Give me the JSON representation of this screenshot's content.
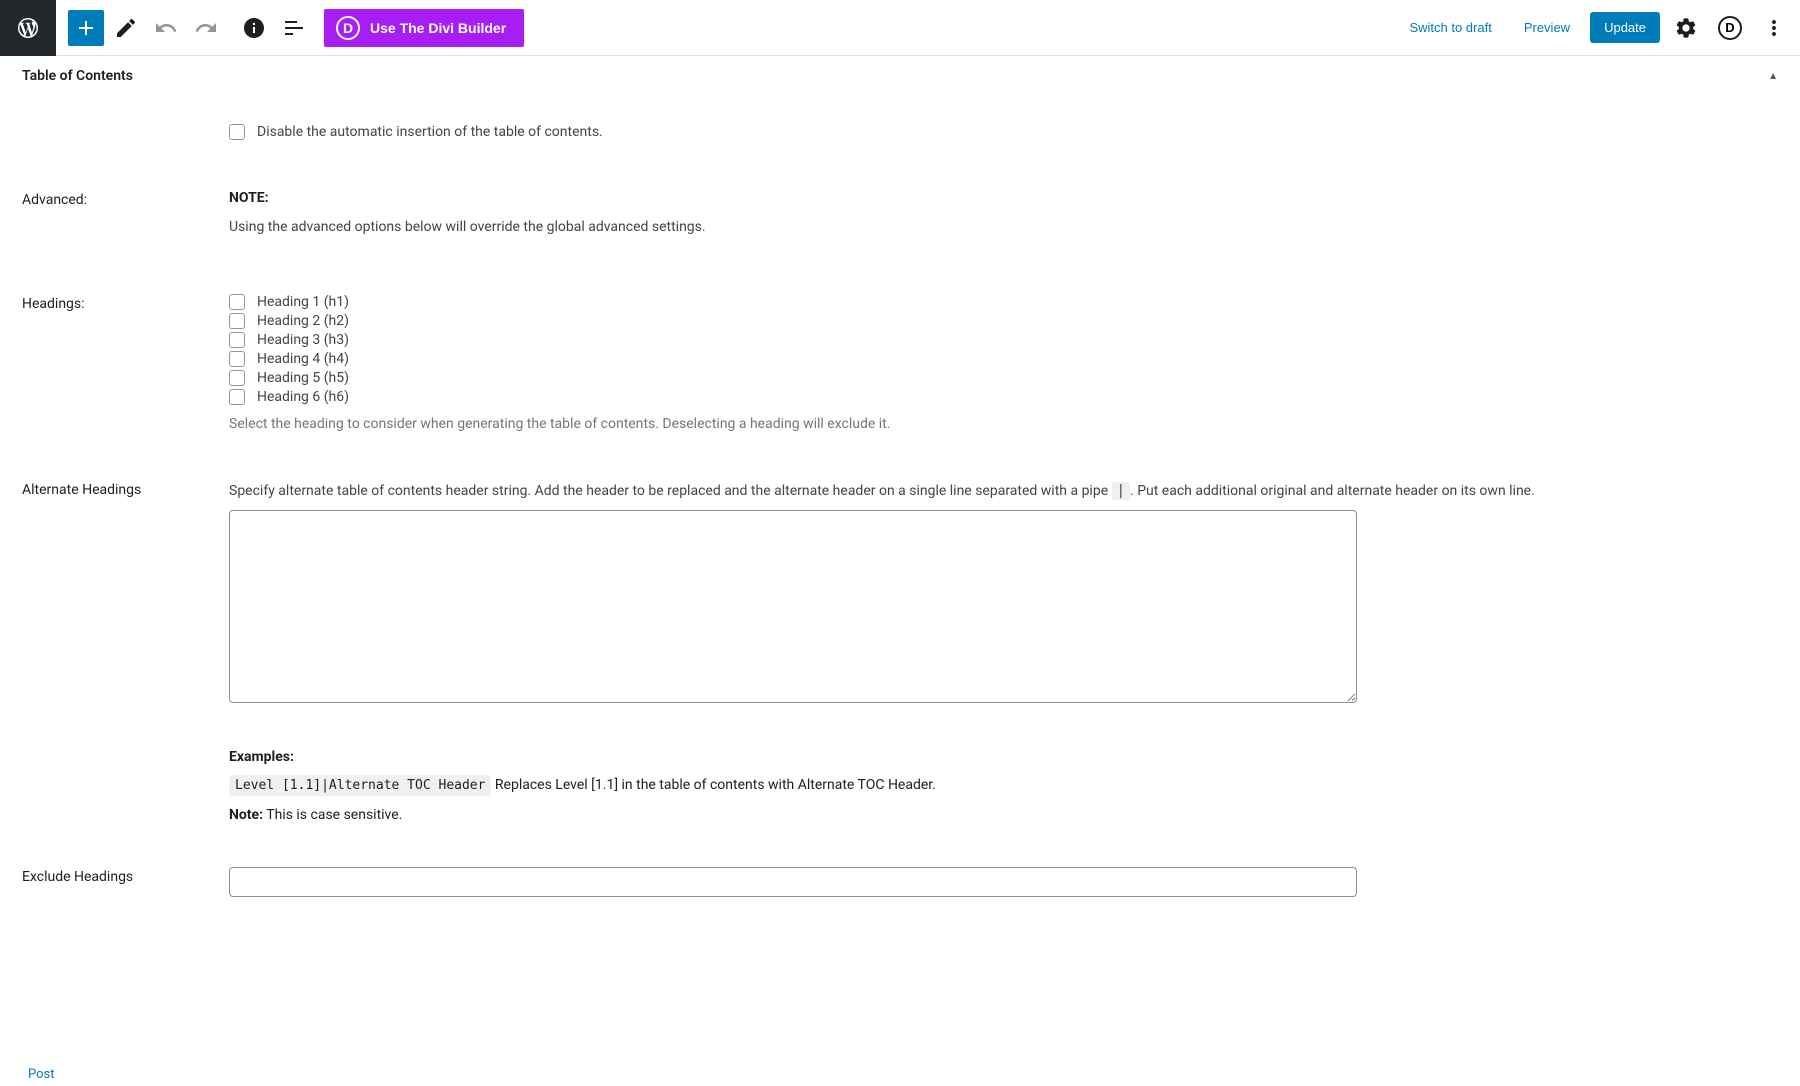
{
  "toolbar": {
    "divi_label": "Use The Divi Builder",
    "switch_draft": "Switch to draft",
    "preview": "Preview",
    "update": "Update"
  },
  "panel": {
    "title": "Table of Contents"
  },
  "disable_row": {
    "checkbox_label": "Disable the automatic insertion of the table of contents."
  },
  "advanced": {
    "label": "Advanced:",
    "note_title": "NOTE:",
    "note_text": "Using the advanced options below will override the global advanced settings."
  },
  "headings": {
    "label": "Headings:",
    "items": [
      "Heading 1 (h1)",
      "Heading 2 (h2)",
      "Heading 3 (h3)",
      "Heading 4 (h4)",
      "Heading 5 (h5)",
      "Heading 6 (h6)"
    ],
    "help": "Select the heading to consider when generating the table of contents. Deselecting a heading will exclude it."
  },
  "alternate": {
    "label": "Alternate Headings",
    "desc_part1": "Specify alternate table of contents header string. Add the header to be replaced and the alternate header on a single line separated with a pipe ",
    "pipe": "|",
    "desc_part2": ". Put each additional original and alternate header on its own line.",
    "examples_title": "Examples:",
    "example_code": "Level [1.1]|Alternate TOC Header",
    "example_text": " Replaces Level [1.1] in the table of contents with Alternate TOC Header.",
    "note_label": "Note:",
    "note_text": " This is case sensitive."
  },
  "exclude": {
    "label": "Exclude Headings"
  },
  "footer": {
    "post_tab": "Post"
  }
}
